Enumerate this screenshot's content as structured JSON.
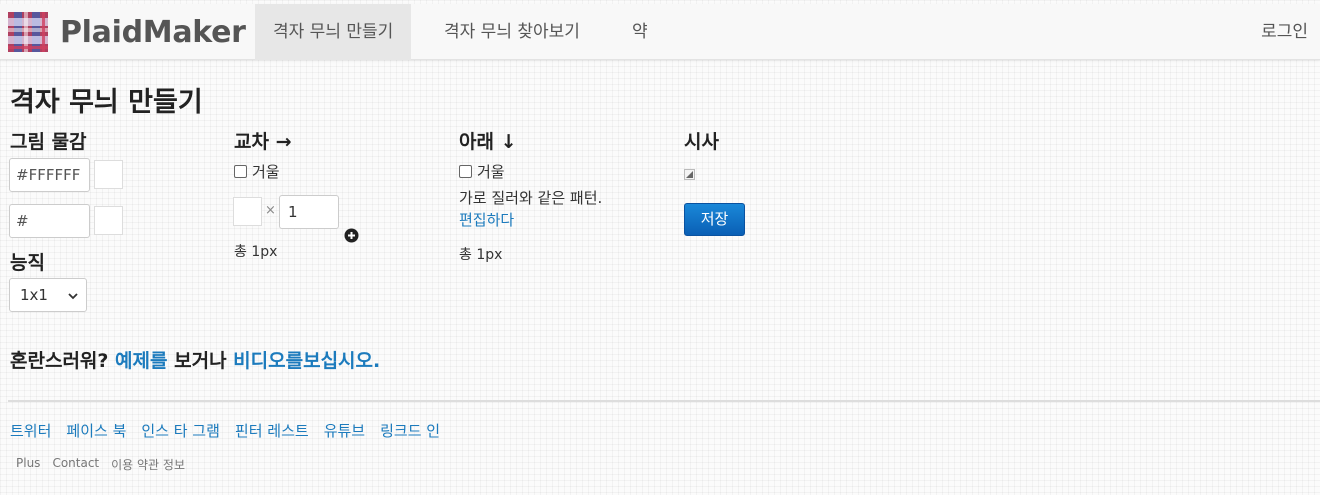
{
  "navbar": {
    "brand": "PlaidMaker",
    "items": [
      {
        "label": "격자 무늬 만들기"
      },
      {
        "label": "격자 무늬 찾아보기"
      },
      {
        "label": "약"
      }
    ],
    "login": "로그인"
  },
  "page_title": "격자 무늬 만들기",
  "material": {
    "heading": "그림 물감",
    "color1_value": "#FFFFFF",
    "color2_value": "#"
  },
  "weave": {
    "heading": "능직",
    "selected": "1x1"
  },
  "across": {
    "heading": "교차 →",
    "mirror_label": "거울",
    "count_value": "1",
    "times": "×",
    "total": "총 1px"
  },
  "down": {
    "heading": "아래 ↓",
    "mirror_label": "거울",
    "description": "가로 질러와 같은 패턴.",
    "edit_link": "편집하다",
    "total": "총 1px"
  },
  "preview": {
    "heading": "시사",
    "save_label": "저장"
  },
  "help": {
    "prefix": "혼란스러워? ",
    "examples_link": "예제를",
    "middle": " 보거나 ",
    "video_link": "비디오를보십시오."
  },
  "social_links": [
    "트위터",
    "페이스 북",
    "인스 타 그램",
    "핀터 레스트",
    "유튜브",
    "링크드 인"
  ],
  "footer_links": [
    "Plus",
    "Contact",
    "이용 약관 정보"
  ],
  "colors": {
    "brand_link": "#1c7bbd",
    "save_button": "#0a6fc6"
  }
}
